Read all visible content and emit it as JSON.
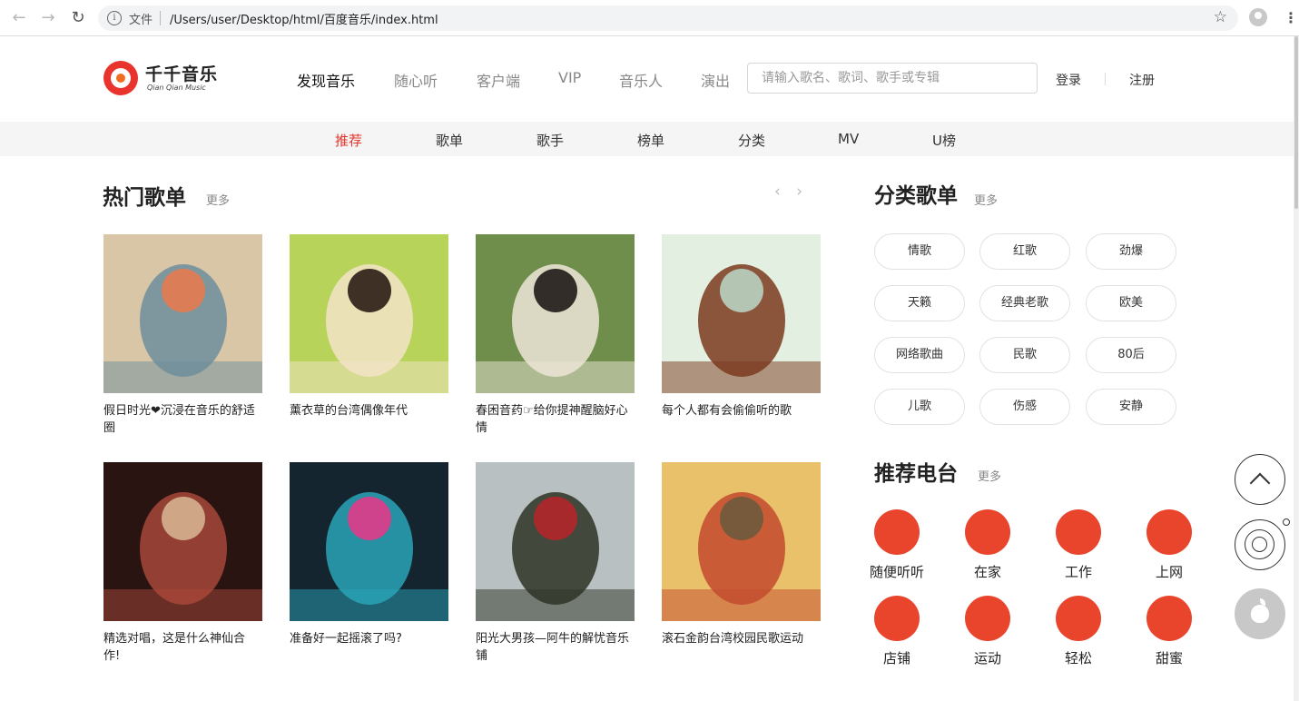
{
  "browser": {
    "scheme_label": "文件",
    "url": "/Users/user/Desktop/html/百度音乐/index.html",
    "icons": [
      "back-icon",
      "forward-icon",
      "reload-icon",
      "info-icon",
      "star-icon",
      "profile-icon",
      "menu-icon"
    ]
  },
  "logo": {
    "name": "千千音乐",
    "subtitle": "Qian Qian Music"
  },
  "main_nav": [
    {
      "label": "发现音乐",
      "active": true
    },
    {
      "label": "随心听",
      "active": false
    },
    {
      "label": "客户端",
      "active": false
    },
    {
      "label": "VIP",
      "active": false
    },
    {
      "label": "音乐人",
      "active": false
    },
    {
      "label": "演出",
      "active": false
    }
  ],
  "search": {
    "placeholder": "请输入歌名、歌词、歌手或专辑",
    "value": ""
  },
  "auth": {
    "login": "登录",
    "register": "注册"
  },
  "sub_nav": [
    {
      "label": "推荐",
      "active": true
    },
    {
      "label": "歌单",
      "active": false
    },
    {
      "label": "歌手",
      "active": false
    },
    {
      "label": "榜单",
      "active": false
    },
    {
      "label": "分类",
      "active": false
    },
    {
      "label": "MV",
      "active": false
    },
    {
      "label": "U榜",
      "active": false
    }
  ],
  "hot_playlists": {
    "title": "热门歌单",
    "more": "更多",
    "arrows": "‹ ›",
    "items": [
      {
        "title": "假日时光❤沉浸在音乐的舒适圈",
        "palette": [
          "#d9c6a6",
          "#6d8e9c",
          "#e67a4f"
        ]
      },
      {
        "title": "薰衣草的台湾偶像年代",
        "palette": [
          "#b7d35a",
          "#f3e3c8",
          "#2b1d14"
        ]
      },
      {
        "title": "春困音药☞给你提神醒脑好心情",
        "palette": [
          "#6f8e4c",
          "#eee6d8",
          "#1f1a17"
        ]
      },
      {
        "title": "每个人都有会偷偷听的歌",
        "palette": [
          "#e3efe0",
          "#7a3a1d",
          "#b9d2c2"
        ]
      },
      {
        "title": "精选对唱，这是什么神仙合作!",
        "palette": [
          "#2a1412",
          "#a7473a",
          "#d5b290"
        ]
      },
      {
        "title": "准备好一起摇滚了吗?",
        "palette": [
          "#152530",
          "#2aa4b8",
          "#e23a8a"
        ]
      },
      {
        "title": "阳光大男孩—阿牛的解忧音乐铺",
        "palette": [
          "#b9c0c2",
          "#2e3325",
          "#b2262a"
        ]
      },
      {
        "title": "滚石金韵台湾校园民歌运动",
        "palette": [
          "#e9c16b",
          "#c34a2e",
          "#6d5a3c"
        ]
      }
    ]
  },
  "category_playlists": {
    "title": "分类歌单",
    "more": "更多",
    "tags": [
      "情歌",
      "红歌",
      "劲爆",
      "天籁",
      "经典老歌",
      "欧美",
      "网络歌曲",
      "民歌",
      "80后",
      "儿歌",
      "伤感",
      "安静"
    ]
  },
  "radio": {
    "title": "推荐电台",
    "more": "更多",
    "accent": "#e8452c",
    "items": [
      "随便听听",
      "在家",
      "工作",
      "上网",
      "店铺",
      "运动",
      "轻松",
      "甜蜜"
    ]
  },
  "floating_tools": [
    "back-to-top-icon",
    "music-disc-icon",
    "apple-icon"
  ],
  "colors": {
    "active_red": "#e5352b",
    "radio_orange": "#e8452c",
    "subnav_bg": "#f5f5f5"
  }
}
